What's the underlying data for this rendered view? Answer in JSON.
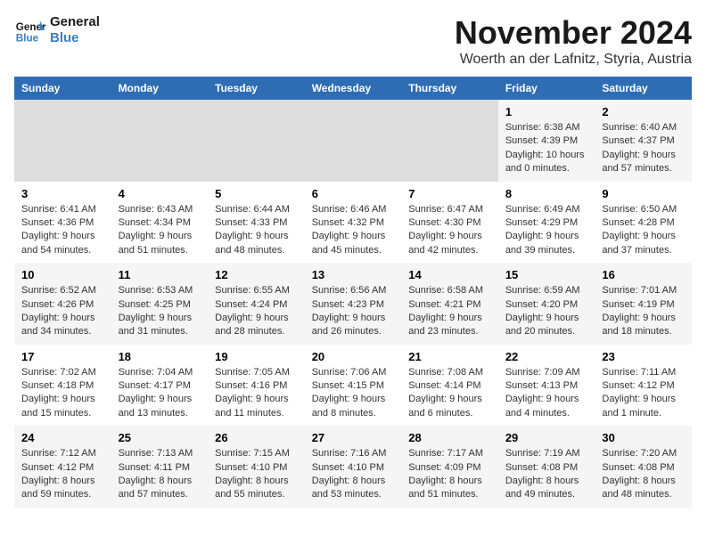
{
  "logo": {
    "line1": "General",
    "line2": "Blue"
  },
  "title": "November 2024",
  "location": "Woerth an der Lafnitz, Styria, Austria",
  "weekdays": [
    "Sunday",
    "Monday",
    "Tuesday",
    "Wednesday",
    "Thursday",
    "Friday",
    "Saturday"
  ],
  "weeks": [
    [
      {
        "day": "",
        "empty": true
      },
      {
        "day": "",
        "empty": true
      },
      {
        "day": "",
        "empty": true
      },
      {
        "day": "",
        "empty": true
      },
      {
        "day": "",
        "empty": true
      },
      {
        "day": "1",
        "sunrise": "6:38 AM",
        "sunset": "4:39 PM",
        "daylight": "10 hours and 0 minutes."
      },
      {
        "day": "2",
        "sunrise": "6:40 AM",
        "sunset": "4:37 PM",
        "daylight": "9 hours and 57 minutes."
      }
    ],
    [
      {
        "day": "3",
        "sunrise": "6:41 AM",
        "sunset": "4:36 PM",
        "daylight": "9 hours and 54 minutes."
      },
      {
        "day": "4",
        "sunrise": "6:43 AM",
        "sunset": "4:34 PM",
        "daylight": "9 hours and 51 minutes."
      },
      {
        "day": "5",
        "sunrise": "6:44 AM",
        "sunset": "4:33 PM",
        "daylight": "9 hours and 48 minutes."
      },
      {
        "day": "6",
        "sunrise": "6:46 AM",
        "sunset": "4:32 PM",
        "daylight": "9 hours and 45 minutes."
      },
      {
        "day": "7",
        "sunrise": "6:47 AM",
        "sunset": "4:30 PM",
        "daylight": "9 hours and 42 minutes."
      },
      {
        "day": "8",
        "sunrise": "6:49 AM",
        "sunset": "4:29 PM",
        "daylight": "9 hours and 39 minutes."
      },
      {
        "day": "9",
        "sunrise": "6:50 AM",
        "sunset": "4:28 PM",
        "daylight": "9 hours and 37 minutes."
      }
    ],
    [
      {
        "day": "10",
        "sunrise": "6:52 AM",
        "sunset": "4:26 PM",
        "daylight": "9 hours and 34 minutes."
      },
      {
        "day": "11",
        "sunrise": "6:53 AM",
        "sunset": "4:25 PM",
        "daylight": "9 hours and 31 minutes."
      },
      {
        "day": "12",
        "sunrise": "6:55 AM",
        "sunset": "4:24 PM",
        "daylight": "9 hours and 28 minutes."
      },
      {
        "day": "13",
        "sunrise": "6:56 AM",
        "sunset": "4:23 PM",
        "daylight": "9 hours and 26 minutes."
      },
      {
        "day": "14",
        "sunrise": "6:58 AM",
        "sunset": "4:21 PM",
        "daylight": "9 hours and 23 minutes."
      },
      {
        "day": "15",
        "sunrise": "6:59 AM",
        "sunset": "4:20 PM",
        "daylight": "9 hours and 20 minutes."
      },
      {
        "day": "16",
        "sunrise": "7:01 AM",
        "sunset": "4:19 PM",
        "daylight": "9 hours and 18 minutes."
      }
    ],
    [
      {
        "day": "17",
        "sunrise": "7:02 AM",
        "sunset": "4:18 PM",
        "daylight": "9 hours and 15 minutes."
      },
      {
        "day": "18",
        "sunrise": "7:04 AM",
        "sunset": "4:17 PM",
        "daylight": "9 hours and 13 minutes."
      },
      {
        "day": "19",
        "sunrise": "7:05 AM",
        "sunset": "4:16 PM",
        "daylight": "9 hours and 11 minutes."
      },
      {
        "day": "20",
        "sunrise": "7:06 AM",
        "sunset": "4:15 PM",
        "daylight": "9 hours and 8 minutes."
      },
      {
        "day": "21",
        "sunrise": "7:08 AM",
        "sunset": "4:14 PM",
        "daylight": "9 hours and 6 minutes."
      },
      {
        "day": "22",
        "sunrise": "7:09 AM",
        "sunset": "4:13 PM",
        "daylight": "9 hours and 4 minutes."
      },
      {
        "day": "23",
        "sunrise": "7:11 AM",
        "sunset": "4:12 PM",
        "daylight": "9 hours and 1 minute."
      }
    ],
    [
      {
        "day": "24",
        "sunrise": "7:12 AM",
        "sunset": "4:12 PM",
        "daylight": "8 hours and 59 minutes."
      },
      {
        "day": "25",
        "sunrise": "7:13 AM",
        "sunset": "4:11 PM",
        "daylight": "8 hours and 57 minutes."
      },
      {
        "day": "26",
        "sunrise": "7:15 AM",
        "sunset": "4:10 PM",
        "daylight": "8 hours and 55 minutes."
      },
      {
        "day": "27",
        "sunrise": "7:16 AM",
        "sunset": "4:10 PM",
        "daylight": "8 hours and 53 minutes."
      },
      {
        "day": "28",
        "sunrise": "7:17 AM",
        "sunset": "4:09 PM",
        "daylight": "8 hours and 51 minutes."
      },
      {
        "day": "29",
        "sunrise": "7:19 AM",
        "sunset": "4:08 PM",
        "daylight": "8 hours and 49 minutes."
      },
      {
        "day": "30",
        "sunrise": "7:20 AM",
        "sunset": "4:08 PM",
        "daylight": "8 hours and 48 minutes."
      }
    ]
  ]
}
